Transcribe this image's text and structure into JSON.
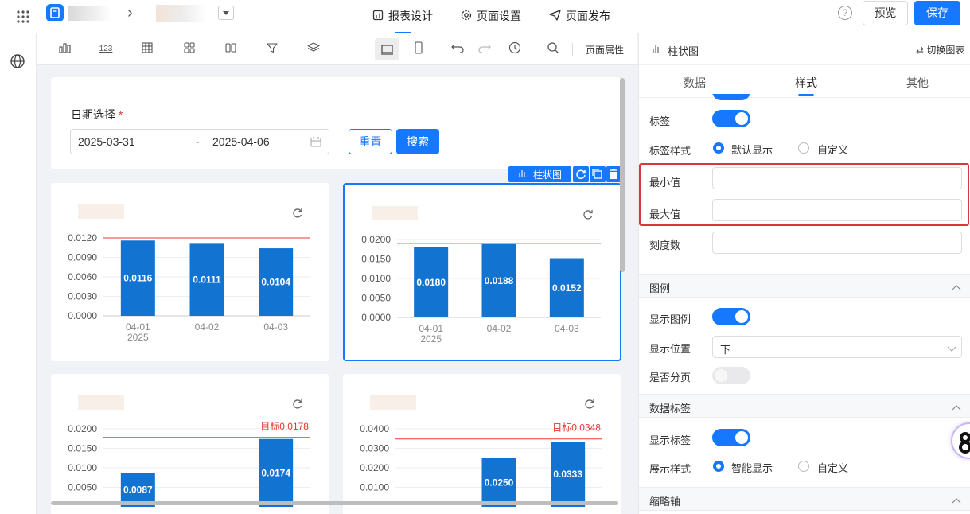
{
  "topbar": {
    "breadcrumb_sep": "›",
    "tabs": [
      {
        "label": "报表设计"
      },
      {
        "label": "页面设置"
      },
      {
        "label": "页面发布"
      }
    ],
    "preview_label": "预览",
    "save_label": "保存"
  },
  "toolbar": {
    "page_props_label": "页面属性",
    "number_icon_text": "123"
  },
  "filter": {
    "label": "日期选择",
    "required_mark": "*",
    "start_date": "2025-03-31",
    "range_sep": "-",
    "end_date": "2025-04-06",
    "reset_label": "重置",
    "search_label": "搜索"
  },
  "selection_badge": {
    "label": "柱状图"
  },
  "charts": [
    {
      "chart_data": {
        "type": "bar",
        "categories": [
          "04-01",
          "04-02",
          "04-03"
        ],
        "category_sub": [
          "2025",
          "",
          ""
        ],
        "values": [
          0.0116,
          0.0111,
          0.0104
        ],
        "value_labels": [
          "0.0116",
          "0.0111",
          "0.0104"
        ],
        "yticks": [
          "0.0120",
          "0.0090",
          "0.0060",
          "0.0030",
          "0.0000"
        ],
        "ylim": [
          0,
          0.012
        ],
        "target": 0.012,
        "target_label": "",
        "bar_color": "#1273d1",
        "target_color": "#e53935"
      }
    },
    {
      "chart_data": {
        "type": "bar",
        "categories": [
          "04-01",
          "04-02",
          "04-03"
        ],
        "category_sub": [
          "2025",
          "",
          ""
        ],
        "values": [
          0.018,
          0.0188,
          0.0152
        ],
        "value_labels": [
          "0.0180",
          "0.0188",
          "0.0152"
        ],
        "yticks": [
          "0.0200",
          "0.0150",
          "0.0100",
          "0.0050",
          "0.0000"
        ],
        "ylim": [
          0,
          0.02
        ],
        "target": 0.019,
        "target_label": "",
        "bar_color": "#1273d1",
        "target_color": "#e53935"
      }
    },
    {
      "chart_data": {
        "type": "bar",
        "categories": [
          "04-01",
          "04-02",
          "04-03"
        ],
        "category_sub": [
          "",
          "",
          ""
        ],
        "values": [
          0.0087,
          null,
          0.0174
        ],
        "value_labels": [
          "0.0087",
          "",
          "0.0174"
        ],
        "yticks": [
          "0.0200",
          "0.0150",
          "0.0100",
          "0.0050"
        ],
        "ylim": [
          0,
          0.02
        ],
        "target": 0.0178,
        "target_label": "目标0.0178",
        "bar_color": "#1273d1",
        "target_color": "#e53935"
      }
    },
    {
      "chart_data": {
        "type": "bar",
        "categories": [
          "04-01",
          "04-02",
          "04-03"
        ],
        "category_sub": [
          "",
          "",
          ""
        ],
        "values": [
          null,
          0.025,
          0.0333
        ],
        "value_labels": [
          "",
          "0.0250",
          "0.0333"
        ],
        "yticks": [
          "0.0400",
          "0.0300",
          "0.0200",
          "0.0100"
        ],
        "ylim": [
          0,
          0.04
        ],
        "target": 0.0348,
        "target_label": "目标0.0348",
        "bar_color": "#1273d1",
        "target_color": "#e53935"
      }
    }
  ],
  "panel": {
    "title": "柱状图",
    "switch_label": "⇄ 切换图表",
    "tabs": [
      {
        "label": "数据"
      },
      {
        "label": "样式"
      },
      {
        "label": "其他"
      }
    ],
    "rows": {
      "label_toggle": "标签",
      "label_style": "标签样式",
      "label_style_opt1": "默认显示",
      "label_style_opt2": "自定义",
      "min_value": "最小值",
      "max_value": "最大值",
      "tick_count": "刻度数"
    },
    "legend_section": {
      "title": "图例",
      "show_legend": "显示图例",
      "position": "显示位置",
      "position_value": "下",
      "paging": "是否分页"
    },
    "datalabel_section": {
      "title": "数据标签",
      "show_label": "显示标签",
      "display_style": "展示样式",
      "opt1": "智能显示",
      "opt2": "自定义"
    },
    "thumbnail_section": {
      "title": "缩略轴"
    }
  },
  "colors": {
    "accent": "#1677ff",
    "highlight_border": "#d9363e"
  },
  "icons": [
    "apps-grid-icon",
    "app-logo-icon",
    "globe-icon",
    "bar-chart-icon",
    "table-icon",
    "filter-icon",
    "layers-icon",
    "desktop-icon",
    "mobile-icon",
    "undo-icon",
    "redo-icon",
    "history-icon",
    "search-icon",
    "help-icon",
    "refresh-icon",
    "copy-icon",
    "delete-icon",
    "calendar-icon",
    "chevron-down-icon",
    "chevron-up-icon"
  ]
}
